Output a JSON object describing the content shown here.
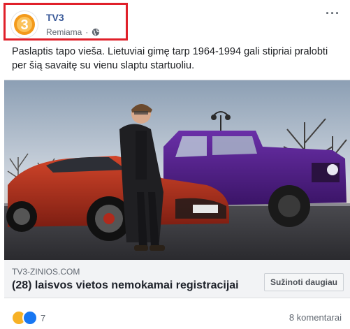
{
  "post": {
    "page_name": "TV3",
    "sponsored_label": "Remiama",
    "separator": "·",
    "text": "Paslaptis tapo vieša. Lietuviai gimę tarp 1964-1994 gali stipriai pralobti per šią savaitę su vienu slaptu startuoliu.",
    "more_icon": "···"
  },
  "link_card": {
    "domain": "TV3-ZINIOS.COM",
    "headline": "(28) laisvos vietos nemokamai registracijai",
    "cta_label": "Sužinoti daugiau"
  },
  "footer": {
    "reaction_count": "7",
    "comments": "8 komentarai"
  },
  "colors": {
    "highlight": "#e0202a",
    "page_name": "#385898",
    "brand_orange": "#f39a1c"
  }
}
